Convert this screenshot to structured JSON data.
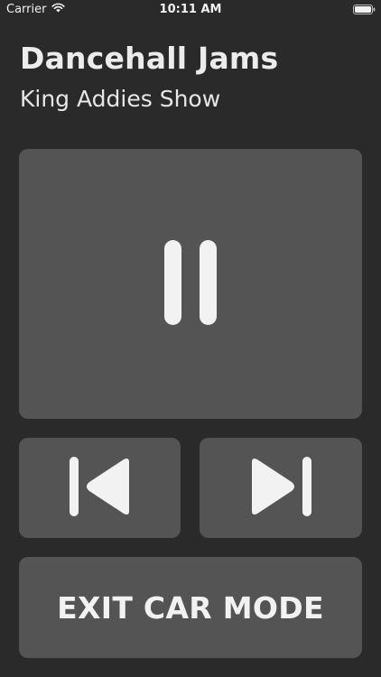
{
  "status_bar": {
    "carrier": "Carrier",
    "time": "10:11 AM",
    "icons": [
      "wifi-icon",
      "battery-icon"
    ]
  },
  "now_playing": {
    "title": "Dancehall Jams",
    "show": "King Addies Show"
  },
  "controls": {
    "play_pause_icon": "pause-icon",
    "previous_icon": "skip-previous-icon",
    "next_icon": "skip-next-icon",
    "exit_label": "EXIT CAR MODE"
  },
  "colors": {
    "background": "#2a2a2a",
    "button": "#545454",
    "foreground": "#f0f0f0"
  }
}
